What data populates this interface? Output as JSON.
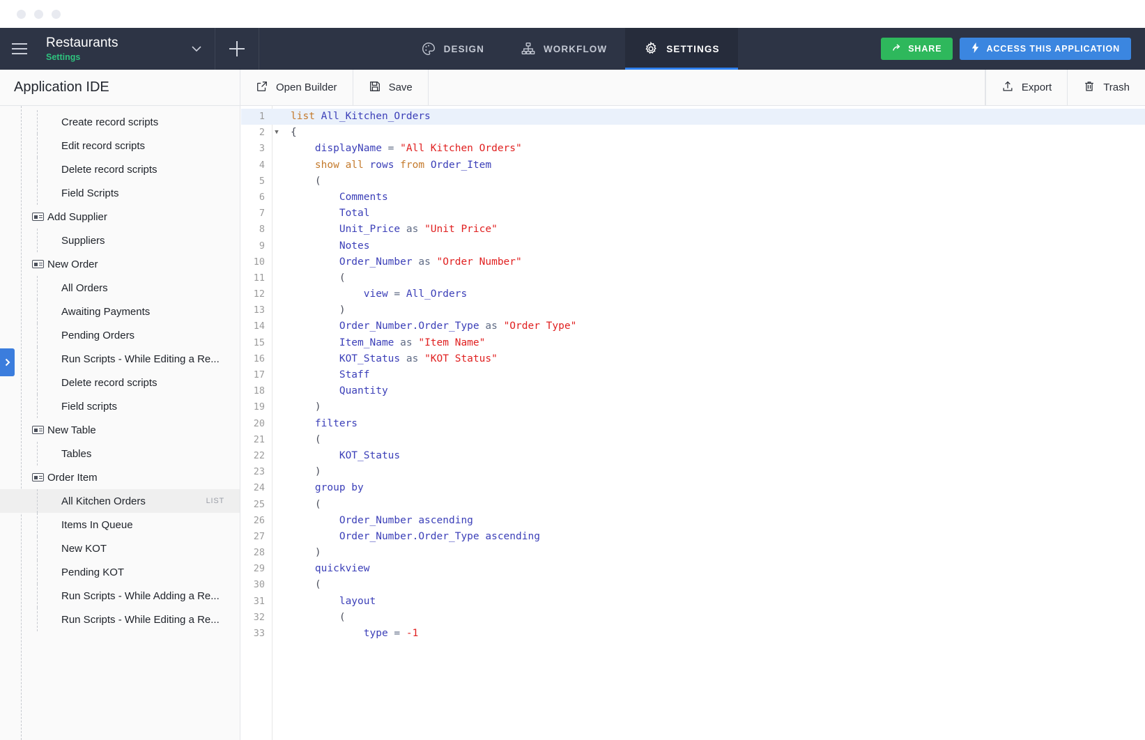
{
  "window": {
    "dots": 3
  },
  "topbar": {
    "menu_icon": "hamburger-icon",
    "app_title": "Restaurants",
    "app_subtitle": "Settings",
    "chevron_icon": "chevron-down-icon",
    "add_icon": "plus-icon",
    "tabs": [
      {
        "label": "DESIGN",
        "icon": "palette-icon",
        "active": false
      },
      {
        "label": "WORKFLOW",
        "icon": "sitemap-icon",
        "active": false
      },
      {
        "label": "SETTINGS",
        "icon": "gear-icon",
        "active": true
      }
    ],
    "share_label": "SHARE",
    "share_icon": "arrow-share-icon",
    "share_color": "#2eb85c",
    "access_label": "ACCESS THIS APPLICATION",
    "access_icon": "bolt-icon",
    "access_color": "#3b86e0",
    "active_underline_color": "#2f80ed",
    "bar_color": "#2d3445",
    "subtitle_color": "#2ec27e"
  },
  "toolbar": {
    "title": "Application IDE",
    "open_builder_label": "Open Builder",
    "open_builder_icon": "external-link-icon",
    "save_label": "Save",
    "save_icon": "floppy-disk-icon",
    "export_label": "Export",
    "export_icon": "upload-icon",
    "trash_label": "Trash",
    "trash_icon": "trash-icon"
  },
  "sidebar": {
    "edge_tab_icon": "chevron-right-icon",
    "edge_tab_color": "#3b7ddd",
    "items": [
      {
        "label": "Create record scripts",
        "type": "leaf",
        "selected": false,
        "badge": ""
      },
      {
        "label": "Edit record scripts",
        "type": "leaf",
        "selected": false,
        "badge": ""
      },
      {
        "label": "Delete record scripts",
        "type": "leaf",
        "selected": false,
        "badge": ""
      },
      {
        "label": "Field Scripts",
        "type": "leaf",
        "selected": false,
        "badge": ""
      },
      {
        "label": "Add Supplier",
        "type": "group",
        "selected": false,
        "badge": ""
      },
      {
        "label": "Suppliers",
        "type": "leaf",
        "selected": false,
        "badge": ""
      },
      {
        "label": "New Order",
        "type": "group",
        "selected": false,
        "badge": ""
      },
      {
        "label": "All Orders",
        "type": "leaf",
        "selected": false,
        "badge": ""
      },
      {
        "label": "Awaiting Payments",
        "type": "leaf",
        "selected": false,
        "badge": ""
      },
      {
        "label": "Pending Orders",
        "type": "leaf",
        "selected": false,
        "badge": ""
      },
      {
        "label": "Run Scripts - While Editing a Re...",
        "type": "leaf",
        "selected": false,
        "badge": ""
      },
      {
        "label": "Delete record scripts",
        "type": "leaf",
        "selected": false,
        "badge": ""
      },
      {
        "label": "Field scripts",
        "type": "leaf",
        "selected": false,
        "badge": ""
      },
      {
        "label": "New Table",
        "type": "group",
        "selected": false,
        "badge": ""
      },
      {
        "label": "Tables",
        "type": "leaf",
        "selected": false,
        "badge": ""
      },
      {
        "label": "Order Item",
        "type": "group",
        "selected": false,
        "badge": ""
      },
      {
        "label": "All Kitchen Orders",
        "type": "leaf",
        "selected": true,
        "badge": "LIST"
      },
      {
        "label": "Items In Queue",
        "type": "leaf",
        "selected": false,
        "badge": ""
      },
      {
        "label": "New KOT",
        "type": "leaf",
        "selected": false,
        "badge": ""
      },
      {
        "label": "Pending KOT",
        "type": "leaf",
        "selected": false,
        "badge": ""
      },
      {
        "label": "Run Scripts - While Adding a Re...",
        "type": "leaf",
        "selected": false,
        "badge": ""
      },
      {
        "label": "Run Scripts - While Editing a Re...",
        "type": "leaf",
        "selected": false,
        "badge": ""
      }
    ]
  },
  "editor": {
    "highlight_line": 1,
    "fold_line": 2,
    "colors": {
      "keyword": "#c47a2c",
      "identifier": "#3b3fb8",
      "string": "#e02020",
      "operator": "#5f6b85",
      "punctuation": "#4b4f5c",
      "line_number": "#9b9b9b",
      "active_line_bg": "#eaf1fb"
    },
    "lines": [
      {
        "n": 1,
        "indent": 0,
        "tokens": [
          {
            "t": "list",
            "c": "kw"
          },
          {
            "t": " ",
            "c": "pn"
          },
          {
            "t": "All_Kitchen_Orders",
            "c": "id"
          }
        ]
      },
      {
        "n": 2,
        "indent": 0,
        "fold": true,
        "tokens": [
          {
            "t": "{",
            "c": "pn"
          }
        ]
      },
      {
        "n": 3,
        "indent": 1,
        "tokens": [
          {
            "t": "displayName",
            "c": "id"
          },
          {
            "t": " = ",
            "c": "op"
          },
          {
            "t": "\"All Kitchen Orders\"",
            "c": "str"
          }
        ]
      },
      {
        "n": 4,
        "indent": 1,
        "tokens": [
          {
            "t": "show",
            "c": "kw"
          },
          {
            "t": " ",
            "c": "pn"
          },
          {
            "t": "all",
            "c": "kw"
          },
          {
            "t": " ",
            "c": "pn"
          },
          {
            "t": "rows",
            "c": "id"
          },
          {
            "t": " ",
            "c": "pn"
          },
          {
            "t": "from",
            "c": "kw"
          },
          {
            "t": " ",
            "c": "pn"
          },
          {
            "t": "Order_Item",
            "c": "id"
          }
        ]
      },
      {
        "n": 5,
        "indent": 1,
        "tokens": [
          {
            "t": "(",
            "c": "pn"
          }
        ]
      },
      {
        "n": 6,
        "indent": 2,
        "tokens": [
          {
            "t": "Comments",
            "c": "id"
          }
        ]
      },
      {
        "n": 7,
        "indent": 2,
        "tokens": [
          {
            "t": "Total",
            "c": "id"
          }
        ]
      },
      {
        "n": 8,
        "indent": 2,
        "tokens": [
          {
            "t": "Unit_Price",
            "c": "id"
          },
          {
            "t": " as ",
            "c": "op"
          },
          {
            "t": "\"Unit Price\"",
            "c": "str"
          }
        ]
      },
      {
        "n": 9,
        "indent": 2,
        "tokens": [
          {
            "t": "Notes",
            "c": "id"
          }
        ]
      },
      {
        "n": 10,
        "indent": 2,
        "tokens": [
          {
            "t": "Order_Number",
            "c": "id"
          },
          {
            "t": " as ",
            "c": "op"
          },
          {
            "t": "\"Order Number\"",
            "c": "str"
          }
        ]
      },
      {
        "n": 11,
        "indent": 2,
        "tokens": [
          {
            "t": "(",
            "c": "pn"
          }
        ]
      },
      {
        "n": 12,
        "indent": 3,
        "tokens": [
          {
            "t": "view",
            "c": "id"
          },
          {
            "t": " = ",
            "c": "op"
          },
          {
            "t": "All_Orders",
            "c": "id"
          }
        ]
      },
      {
        "n": 13,
        "indent": 2,
        "tokens": [
          {
            "t": ")",
            "c": "pn"
          }
        ]
      },
      {
        "n": 14,
        "indent": 2,
        "tokens": [
          {
            "t": "Order_Number.Order_Type",
            "c": "id"
          },
          {
            "t": " as ",
            "c": "op"
          },
          {
            "t": "\"Order Type\"",
            "c": "str"
          }
        ]
      },
      {
        "n": 15,
        "indent": 2,
        "tokens": [
          {
            "t": "Item_Name",
            "c": "id"
          },
          {
            "t": " as ",
            "c": "op"
          },
          {
            "t": "\"Item Name\"",
            "c": "str"
          }
        ]
      },
      {
        "n": 16,
        "indent": 2,
        "tokens": [
          {
            "t": "KOT_Status",
            "c": "id"
          },
          {
            "t": " as ",
            "c": "op"
          },
          {
            "t": "\"KOT Status\"",
            "c": "str"
          }
        ]
      },
      {
        "n": 17,
        "indent": 2,
        "tokens": [
          {
            "t": "Staff",
            "c": "id"
          }
        ]
      },
      {
        "n": 18,
        "indent": 2,
        "tokens": [
          {
            "t": "Quantity",
            "c": "id"
          }
        ]
      },
      {
        "n": 19,
        "indent": 1,
        "tokens": [
          {
            "t": ")",
            "c": "pn"
          }
        ]
      },
      {
        "n": 20,
        "indent": 1,
        "tokens": [
          {
            "t": "filters",
            "c": "id"
          }
        ]
      },
      {
        "n": 21,
        "indent": 1,
        "tokens": [
          {
            "t": "(",
            "c": "pn"
          }
        ]
      },
      {
        "n": 22,
        "indent": 2,
        "tokens": [
          {
            "t": "KOT_Status",
            "c": "id"
          }
        ]
      },
      {
        "n": 23,
        "indent": 1,
        "tokens": [
          {
            "t": ")",
            "c": "pn"
          }
        ]
      },
      {
        "n": 24,
        "indent": 1,
        "tokens": [
          {
            "t": "group by",
            "c": "id"
          }
        ]
      },
      {
        "n": 25,
        "indent": 1,
        "tokens": [
          {
            "t": "(",
            "c": "pn"
          }
        ]
      },
      {
        "n": 26,
        "indent": 2,
        "tokens": [
          {
            "t": "Order_Number ascending",
            "c": "id"
          }
        ]
      },
      {
        "n": 27,
        "indent": 2,
        "tokens": [
          {
            "t": "Order_Number.Order_Type ascending",
            "c": "id"
          }
        ]
      },
      {
        "n": 28,
        "indent": 1,
        "tokens": [
          {
            "t": ")",
            "c": "pn"
          }
        ]
      },
      {
        "n": 29,
        "indent": 1,
        "tokens": [
          {
            "t": "quickview",
            "c": "id"
          }
        ]
      },
      {
        "n": 30,
        "indent": 1,
        "tokens": [
          {
            "t": "(",
            "c": "pn"
          }
        ]
      },
      {
        "n": 31,
        "indent": 2,
        "tokens": [
          {
            "t": "layout",
            "c": "id"
          }
        ]
      },
      {
        "n": 32,
        "indent": 2,
        "tokens": [
          {
            "t": "(",
            "c": "pn"
          }
        ]
      },
      {
        "n": 33,
        "indent": 3,
        "tokens": [
          {
            "t": "type",
            "c": "id"
          },
          {
            "t": " = ",
            "c": "op"
          },
          {
            "t": "-1",
            "c": "num"
          }
        ]
      }
    ]
  }
}
